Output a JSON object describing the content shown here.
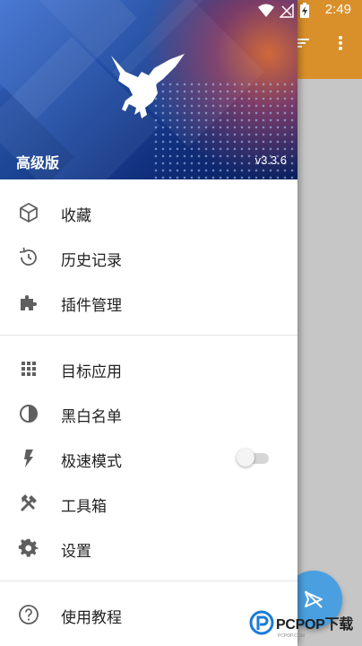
{
  "status_bar": {
    "time": "2:49"
  },
  "drawer": {
    "header": {
      "title": "高级版",
      "version": "v3.3.6"
    },
    "section1": [
      {
        "label": "收藏",
        "icon": "box-icon"
      },
      {
        "label": "历史记录",
        "icon": "history-icon"
      },
      {
        "label": "插件管理",
        "icon": "puzzle-icon"
      }
    ],
    "section2": [
      {
        "label": "目标应用",
        "icon": "grid-icon"
      },
      {
        "label": "黑白名单",
        "icon": "half-circle-icon"
      },
      {
        "label": "极速模式",
        "icon": "bolt-icon",
        "toggle": false
      },
      {
        "label": "工具箱",
        "icon": "tools-icon"
      },
      {
        "label": "设置",
        "icon": "gear-icon"
      }
    ],
    "section3": [
      {
        "label": "使用教程",
        "icon": "help-icon"
      }
    ]
  },
  "watermark": {
    "text": "PCPOP下载",
    "sub": "PCPOP.COM"
  },
  "colors": {
    "toolbar": "#d9902a",
    "fab": "#4a9fe0",
    "header_dark": "#0f2c78"
  }
}
